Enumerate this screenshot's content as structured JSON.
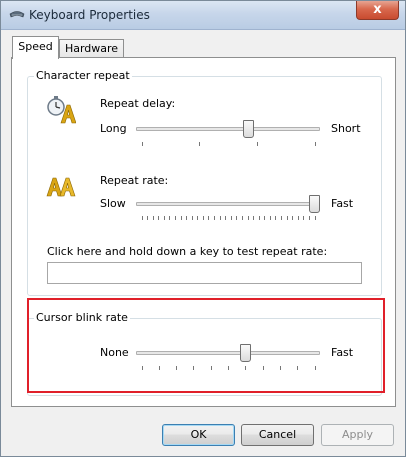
{
  "window": {
    "title": "Keyboard Properties",
    "close_symbol": "x"
  },
  "tabs": [
    {
      "label": "Speed",
      "active": true
    },
    {
      "label": "Hardware",
      "active": false
    }
  ],
  "character_repeat": {
    "legend": "Character repeat",
    "repeat_delay": {
      "label": "Repeat delay:",
      "min_label": "Long",
      "max_label": "Short",
      "value_fraction": 0.62,
      "ticks": 4,
      "icon": "stopwatch-letter-icon"
    },
    "repeat_rate": {
      "label": "Repeat rate:",
      "min_label": "Slow",
      "max_label": "Fast",
      "value_fraction": 1.0,
      "ticks": 32,
      "icon": "double-letter-a-icon"
    },
    "test_label": "Click here and hold down a key to test repeat rate:",
    "test_value": ""
  },
  "cursor_blink": {
    "legend": "Cursor blink rate",
    "min_label": "None",
    "max_label": "Fast",
    "value_fraction": 0.6,
    "ticks": 11,
    "highlight_color": "#e0202a"
  },
  "buttons": {
    "ok": "OK",
    "cancel": "Cancel",
    "apply": "Apply"
  }
}
